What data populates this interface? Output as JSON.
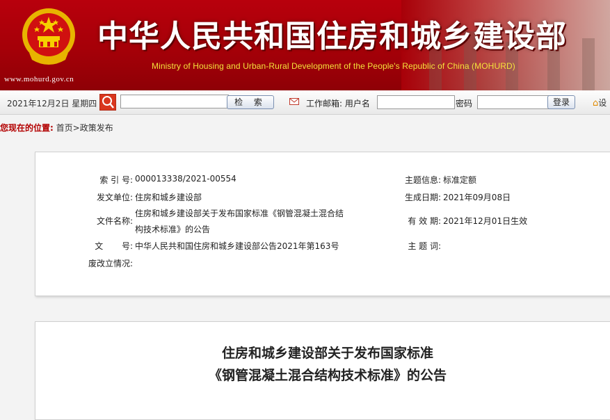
{
  "banner": {
    "title_cn": "中华人民共和国住房和城乡建设部",
    "title_en": "Ministry of Housing and Urban-Rural Development of the People's Republic of China (MOHURD)",
    "url": "www.mohurd.gov.cn",
    "colors": {
      "background": "#a50008",
      "title_text": "#ffffff",
      "subtitle_text": "#f4e23c"
    }
  },
  "toolbar": {
    "date": "2021年12月2日 星期四",
    "search_placeholder": "",
    "search_label": "检 索",
    "mail_icon": "envelope-icon",
    "mail_label": "工作邮箱: 用户名",
    "password_label": "密码",
    "login_label": "登录",
    "home_label": "设"
  },
  "breadcrumb": {
    "label": "您现在的位置:",
    "path": "首页>政策发布"
  },
  "info": {
    "index_label": "索 引 号:",
    "index_value": "000013338/2021-00554",
    "topic_label": "主题信息:",
    "topic_value": "标准定额",
    "issuer_label": "发文单位:",
    "issuer_value": "住房和城乡建设部",
    "date_label": "生成日期:",
    "date_value": "2021年09月08日",
    "name_label": "文件名称:",
    "name_value_line1": "住房和城乡建设部关于发布国家标准《钢管混凝土混合结",
    "name_value_line2": "构技术标准》的公告",
    "valid_label": "有 效 期:",
    "valid_value": "2021年12月01日生效",
    "doc_label": "文       号:",
    "doc_value": "中华人民共和国住房和城乡建设部公告2021年第163号",
    "keywords_label": "主 题 词:",
    "keywords_value": "",
    "status_label": "废改立情况:",
    "status_value": ""
  },
  "article": {
    "title_line1": "住房和城乡建设部关于发布国家标准",
    "title_line2": "《钢管混凝土混合结构技术标准》的公告"
  }
}
